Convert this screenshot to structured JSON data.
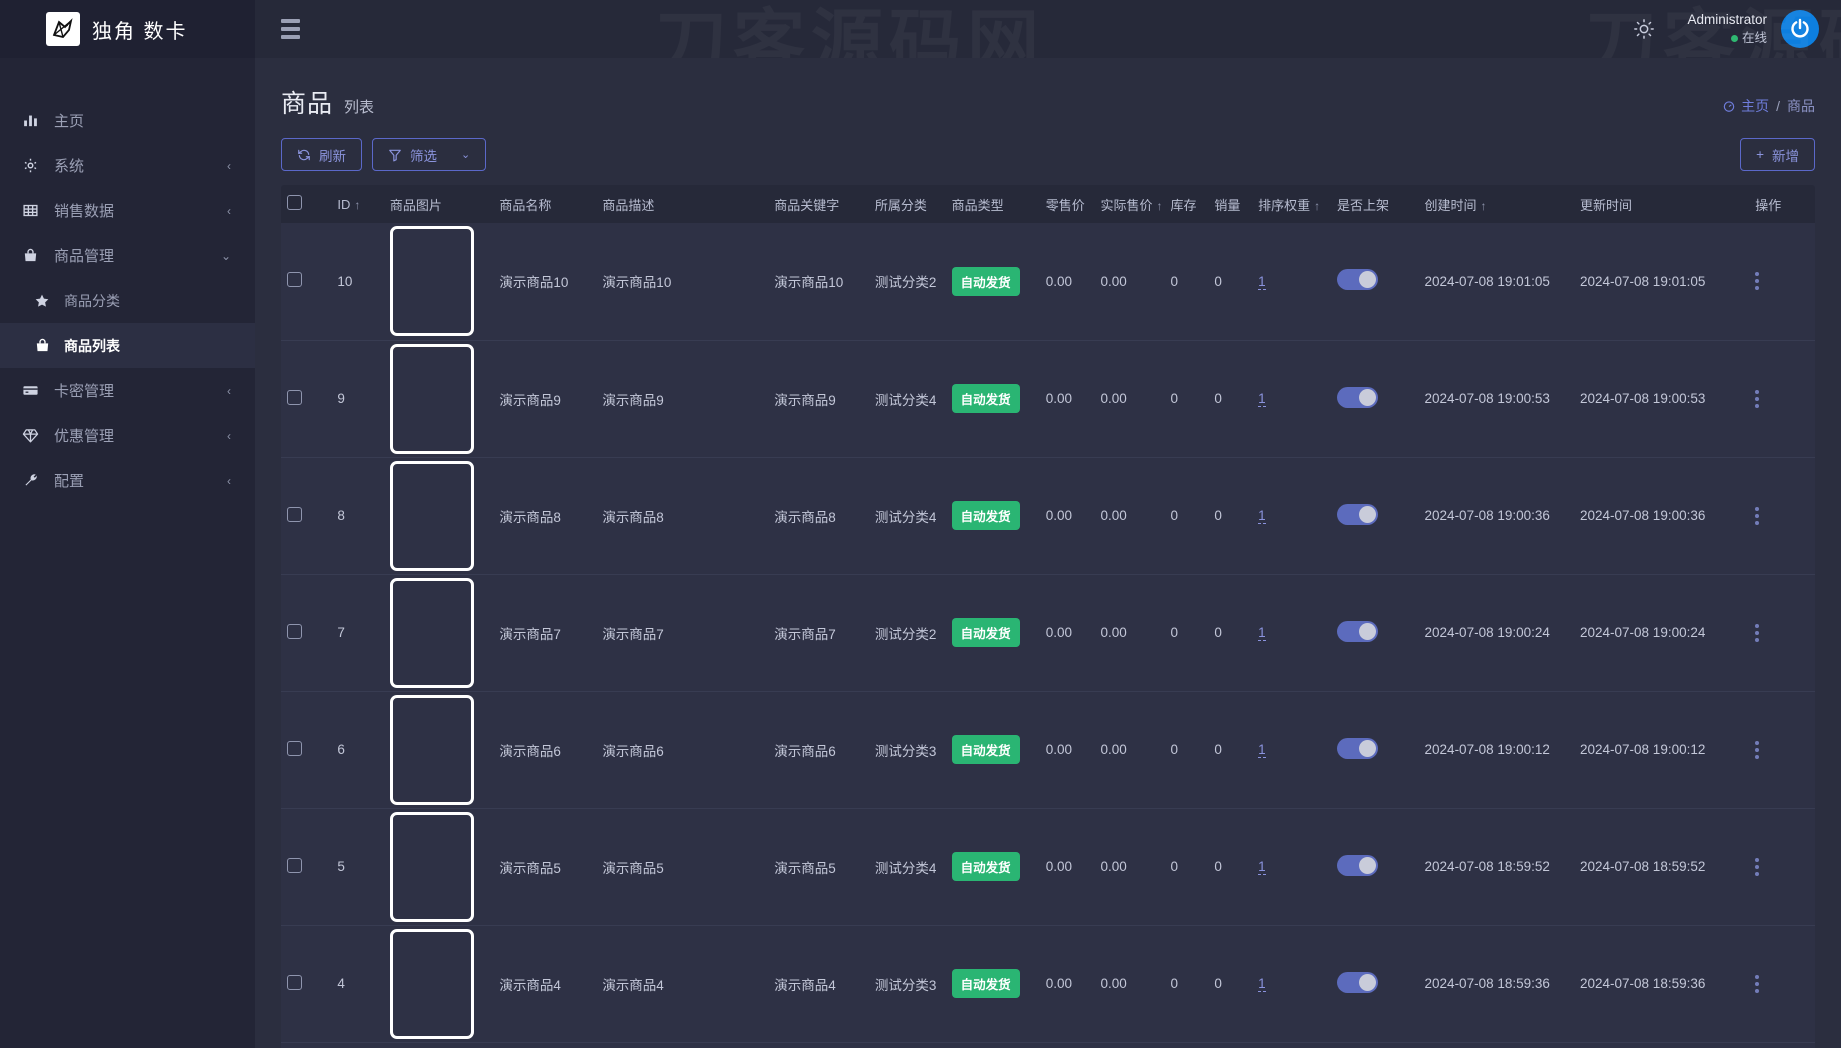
{
  "brand": {
    "title": "独角 数卡",
    "logo_icon": "unicorn-logo-icon"
  },
  "sidebar": {
    "items": [
      {
        "label": "主页",
        "icon": "bar-chart-icon",
        "caret": "",
        "active": false,
        "sub": false
      },
      {
        "label": "系统",
        "icon": "gear-icon",
        "caret": "‹",
        "active": false,
        "sub": false
      },
      {
        "label": "销售数据",
        "icon": "grid-icon",
        "caret": "‹",
        "active": false,
        "sub": false
      },
      {
        "label": "商品管理",
        "icon": "bag-icon",
        "caret": "⌄",
        "active": false,
        "sub": false
      },
      {
        "label": "商品分类",
        "icon": "star-icon",
        "caret": "",
        "active": false,
        "sub": true
      },
      {
        "label": "商品列表",
        "icon": "bag-icon",
        "caret": "",
        "active": true,
        "sub": true
      },
      {
        "label": "卡密管理",
        "icon": "card-icon",
        "caret": "‹",
        "active": false,
        "sub": false
      },
      {
        "label": "优惠管理",
        "icon": "diamond-icon",
        "caret": "‹",
        "active": false,
        "sub": false
      },
      {
        "label": "配置",
        "icon": "wrench-icon",
        "caret": "‹",
        "active": false,
        "sub": false
      }
    ]
  },
  "topbar": {
    "menu_icon": "hamburger-icon",
    "theme_icon": "sun-icon",
    "user_name": "Administrator",
    "user_status": "在线",
    "avatar_icon": "power-icon",
    "watermark": "刀客源码网"
  },
  "page": {
    "title": "商品",
    "subtitle": "列表",
    "breadcrumb": {
      "home_icon": "dashboard-icon",
      "home": "主页",
      "separator": "/",
      "current": "商品"
    }
  },
  "toolbar": {
    "refresh_label": "刷新",
    "refresh_icon": "refresh-icon",
    "filter_label": "筛选",
    "filter_icon": "funnel-icon",
    "filter_caret": "⌄",
    "add_label": "新增",
    "add_icon": "plus-icon"
  },
  "table": {
    "headers": [
      {
        "label": "",
        "sort": "",
        "cls": "c-cb"
      },
      {
        "label": "ID",
        "sort": "↑",
        "cls": "c-id"
      },
      {
        "label": "商品图片",
        "sort": "",
        "cls": "c-img"
      },
      {
        "label": "商品名称",
        "sort": "",
        "cls": "c-name"
      },
      {
        "label": "商品描述",
        "sort": "",
        "cls": "c-desc"
      },
      {
        "label": "商品关键字",
        "sort": "",
        "cls": "c-kw"
      },
      {
        "label": "所属分类",
        "sort": "",
        "cls": "c-cat"
      },
      {
        "label": "商品类型",
        "sort": "",
        "cls": "c-type"
      },
      {
        "label": "零售价",
        "sort": "",
        "cls": "c-price"
      },
      {
        "label": "实际售价",
        "sort": "↑",
        "cls": "c-real"
      },
      {
        "label": "库存",
        "sort": "",
        "cls": "c-stock"
      },
      {
        "label": "销量",
        "sort": "",
        "cls": "c-sold"
      },
      {
        "label": "排序权重",
        "sort": "↑",
        "cls": "c-sort"
      },
      {
        "label": "是否上架",
        "sort": "",
        "cls": "c-on"
      },
      {
        "label": "创建时间",
        "sort": "↑",
        "cls": "c-ct"
      },
      {
        "label": "更新时间",
        "sort": "",
        "cls": "c-ut"
      },
      {
        "label": "操作",
        "sort": "",
        "cls": "c-op"
      }
    ],
    "rows": [
      {
        "id": "10",
        "name": "演示商品10",
        "desc": "演示商品10",
        "keyword": "演示商品10",
        "category": "测试分类2",
        "type": "自动发货",
        "price": "0.00",
        "real_price": "0.00",
        "stock": "0",
        "sold": "0",
        "weight": "1",
        "on_shelf": true,
        "created": "2024-07-08 19:01:05",
        "updated": "2024-07-08 19:01:05",
        "img": "g10"
      },
      {
        "id": "9",
        "name": "演示商品9",
        "desc": "演示商品9",
        "keyword": "演示商品9",
        "category": "测试分类4",
        "type": "自动发货",
        "price": "0.00",
        "real_price": "0.00",
        "stock": "0",
        "sold": "0",
        "weight": "1",
        "on_shelf": true,
        "created": "2024-07-08 19:00:53",
        "updated": "2024-07-08 19:00:53",
        "img": "g9"
      },
      {
        "id": "8",
        "name": "演示商品8",
        "desc": "演示商品8",
        "keyword": "演示商品8",
        "category": "测试分类4",
        "type": "自动发货",
        "price": "0.00",
        "real_price": "0.00",
        "stock": "0",
        "sold": "0",
        "weight": "1",
        "on_shelf": true,
        "created": "2024-07-08 19:00:36",
        "updated": "2024-07-08 19:00:36",
        "img": "g8"
      },
      {
        "id": "7",
        "name": "演示商品7",
        "desc": "演示商品7",
        "keyword": "演示商品7",
        "category": "测试分类2",
        "type": "自动发货",
        "price": "0.00",
        "real_price": "0.00",
        "stock": "0",
        "sold": "0",
        "weight": "1",
        "on_shelf": true,
        "created": "2024-07-08 19:00:24",
        "updated": "2024-07-08 19:00:24",
        "img": "g7"
      },
      {
        "id": "6",
        "name": "演示商品6",
        "desc": "演示商品6",
        "keyword": "演示商品6",
        "category": "测试分类3",
        "type": "自动发货",
        "price": "0.00",
        "real_price": "0.00",
        "stock": "0",
        "sold": "0",
        "weight": "1",
        "on_shelf": true,
        "created": "2024-07-08 19:00:12",
        "updated": "2024-07-08 19:00:12",
        "img": "g6"
      },
      {
        "id": "5",
        "name": "演示商品5",
        "desc": "演示商品5",
        "keyword": "演示商品5",
        "category": "测试分类4",
        "type": "自动发货",
        "price": "0.00",
        "real_price": "0.00",
        "stock": "0",
        "sold": "0",
        "weight": "1",
        "on_shelf": true,
        "created": "2024-07-08 18:59:52",
        "updated": "2024-07-08 18:59:52",
        "img": "g5"
      },
      {
        "id": "4",
        "name": "演示商品4",
        "desc": "演示商品4",
        "keyword": "演示商品4",
        "category": "测试分类3",
        "type": "自动发货",
        "price": "0.00",
        "real_price": "0.00",
        "stock": "0",
        "sold": "0",
        "weight": "1",
        "on_shelf": true,
        "created": "2024-07-08 18:59:36",
        "updated": "2024-07-08 18:59:36",
        "img": "g4"
      }
    ]
  },
  "colors": {
    "accent": "#5b68c9",
    "badge_green": "#2ab573",
    "online_green": "#2fb872",
    "avatar_blue": "#0d7fe0",
    "sidebar_bg": "#232536",
    "content_bg": "#2b2e3f",
    "table_bg": "#2e3145"
  }
}
